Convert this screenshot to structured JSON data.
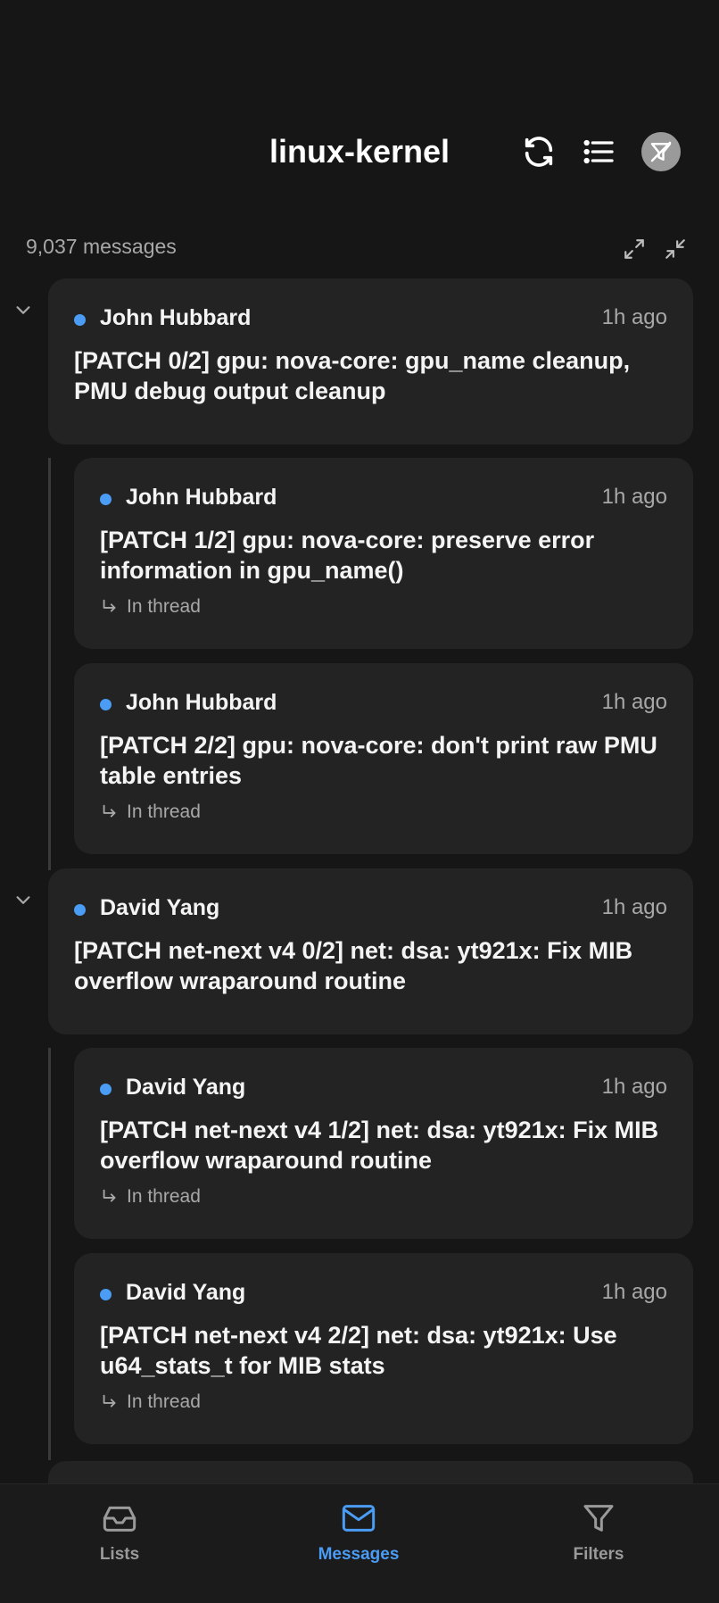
{
  "header": {
    "title": "linux-kernel"
  },
  "summary": {
    "count_text": "9,037 messages"
  },
  "threads": [
    {
      "root": {
        "author": "John Hubbard",
        "time": "1h ago",
        "subject": "[PATCH 0/2] gpu: nova-core: gpu_name cleanup, PMU debug output cleanup"
      },
      "replies": [
        {
          "author": "John Hubbard",
          "time": "1h ago",
          "subject": "[PATCH 1/2] gpu: nova-core: preserve error information in gpu_name()",
          "thread_label": "In thread"
        },
        {
          "author": "John Hubbard",
          "time": "1h ago",
          "subject": "[PATCH 2/2] gpu: nova-core: don't print raw PMU table entries",
          "thread_label": "In thread"
        }
      ]
    },
    {
      "root": {
        "author": "David Yang",
        "time": "1h ago",
        "subject": "[PATCH net-next v4 0/2] net: dsa: yt921x: Fix MIB overflow wraparound routine"
      },
      "replies": [
        {
          "author": "David Yang",
          "time": "1h ago",
          "subject": "[PATCH net-next v4 1/2] net: dsa: yt921x: Fix MIB overflow wraparound routine",
          "thread_label": "In thread"
        },
        {
          "author": "David Yang",
          "time": "1h ago",
          "subject": "[PATCH net-next v4 2/2] net: dsa: yt921x: Use u64_stats_t for MIB stats",
          "thread_label": "In thread"
        }
      ]
    }
  ],
  "nav": {
    "lists": "Lists",
    "messages": "Messages",
    "filters": "Filters",
    "active": "messages"
  },
  "colors": {
    "accent": "#4a9cf5",
    "unread_dot": "#4a9cf5",
    "card": "#232323",
    "background": "#161616"
  }
}
